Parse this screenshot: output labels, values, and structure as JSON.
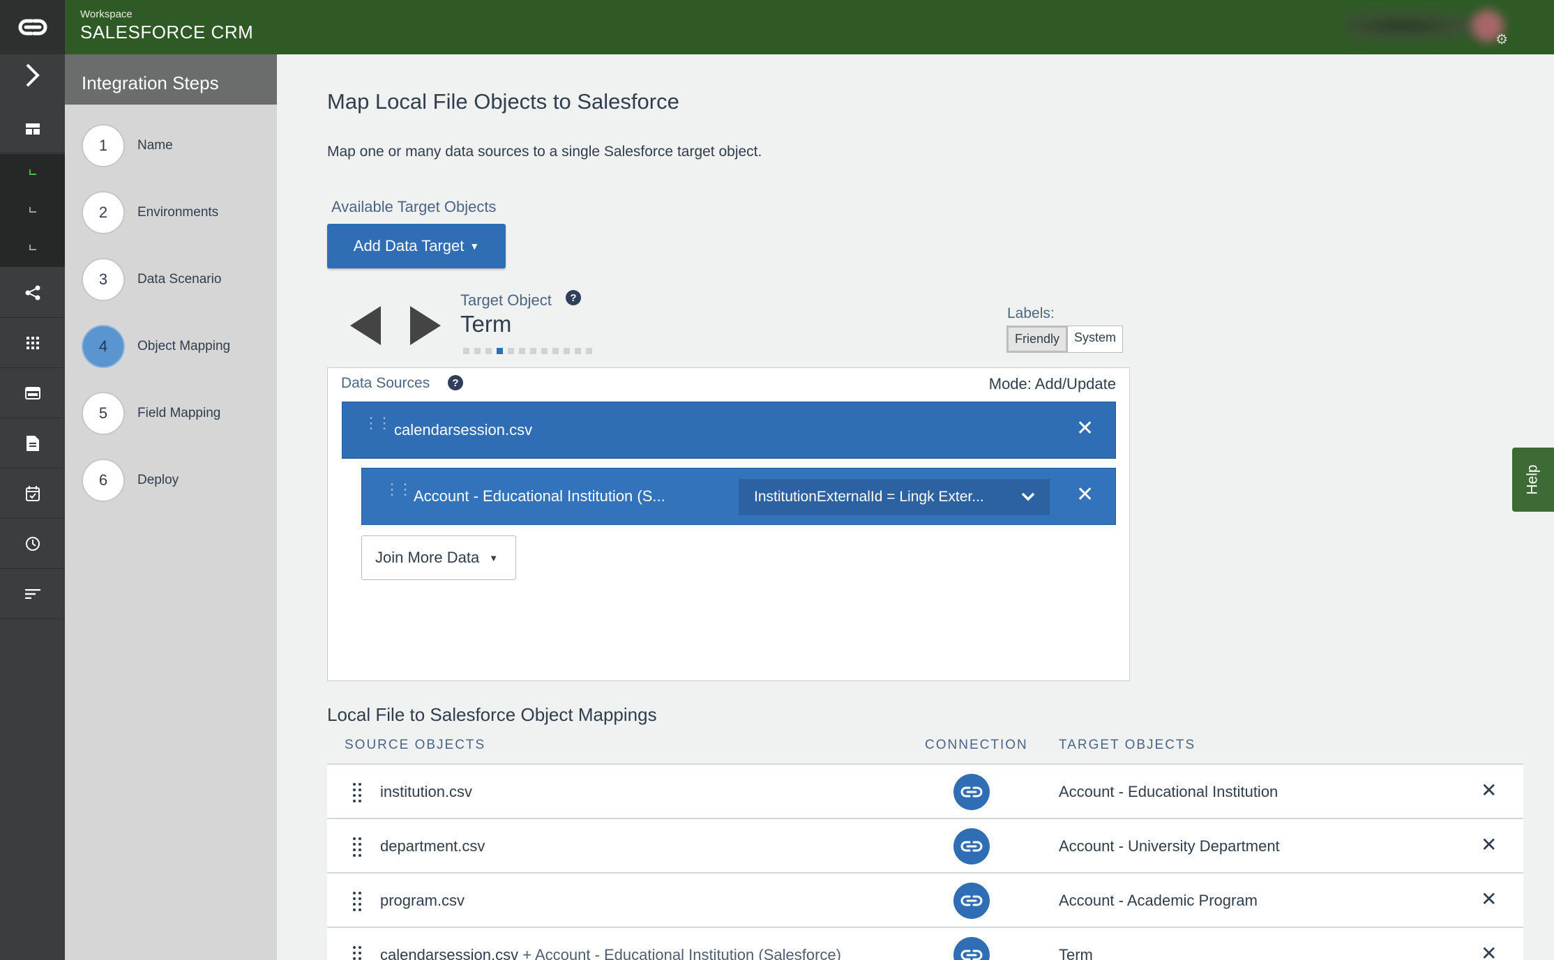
{
  "header": {
    "workspace_label": "Workspace",
    "workspace_name": "SALESFORCE CRM"
  },
  "steps": {
    "title": "Integration Steps",
    "items": [
      {
        "number": "1",
        "label": "Name"
      },
      {
        "number": "2",
        "label": "Environments"
      },
      {
        "number": "3",
        "label": "Data Scenario"
      },
      {
        "number": "4",
        "label": "Object Mapping",
        "active": true
      },
      {
        "number": "5",
        "label": "Field Mapping"
      },
      {
        "number": "6",
        "label": "Deploy"
      }
    ]
  },
  "main": {
    "title": "Map Local File Objects to Salesforce",
    "description": "Map one or many data sources to a single Salesforce target object.",
    "available_label": "Available Target Objects",
    "add_target_label": "Add Data Target",
    "target_object_label": "Target Object",
    "target_object_name": "Term",
    "pager": {
      "total": 12,
      "current_index": 3
    },
    "labels_title": "Labels:",
    "labels_options": [
      "Friendly",
      "System"
    ],
    "labels_selected": "Friendly"
  },
  "data_sources": {
    "title": "Data Sources",
    "mode": "Mode: Add/Update",
    "primary": "calendarsession.csv",
    "joined": "Account - Educational Institution (S...",
    "join_condition": "InstitutionExternalId = Lingk Exter...",
    "join_more_label": "Join More Data"
  },
  "mappings": {
    "title": "Local File to Salesforce Object Mappings",
    "columns": [
      "SOURCE OBJECTS",
      "CONNECTION",
      "TARGET OBJECTS"
    ],
    "rows": [
      {
        "source": "institution.csv",
        "source_extra": "",
        "target": "Account - Educational Institution"
      },
      {
        "source": "department.csv",
        "source_extra": "",
        "target": "Account - University Department"
      },
      {
        "source": "program.csv",
        "source_extra": "",
        "target": "Account - Academic Program"
      },
      {
        "source": "calendarsession.csv",
        "source_extra": " + Account - Educational Institution (Salesforce)",
        "target": "Term"
      }
    ]
  },
  "help_tab": "Help",
  "icons": {
    "rail": [
      "link-logo-icon",
      "chevron-right-icon",
      "dashboard-icon",
      "share-icon",
      "grid-icon",
      "window-icon",
      "document-icon",
      "calendar-check-icon",
      "clock-icon",
      "sort-lines-icon"
    ],
    "connection": "link-icon"
  },
  "colors": {
    "header_green": "#2f5a26",
    "primary_blue": "#2f6eb5",
    "active_step": "#5b95d0",
    "rail_dark": "#3b3d3e"
  }
}
